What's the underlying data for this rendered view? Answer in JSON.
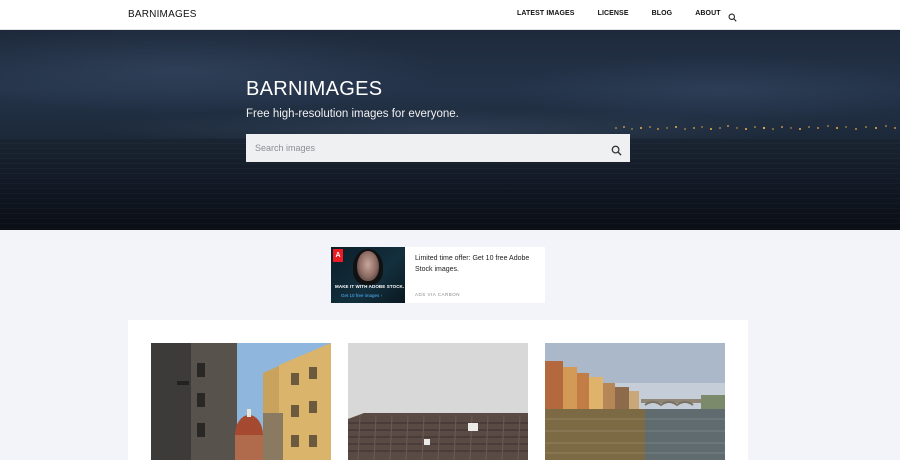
{
  "site": {
    "logo": "BARNIMAGES"
  },
  "nav": {
    "items": [
      {
        "label": "LATEST IMAGES"
      },
      {
        "label": "LICENSE"
      },
      {
        "label": "BLOG"
      },
      {
        "label": "ABOUT"
      }
    ],
    "search_icon": "search-icon"
  },
  "hero": {
    "title": "BARNIMAGES",
    "tagline": "Free high-resolution images for everyone.",
    "search_placeholder": "Search images",
    "search_icon": "search-icon"
  },
  "ad": {
    "caption": "MAKE IT WITH ADOBE STOCK.",
    "cta": "Get 10 free images ›",
    "logo": "Adobe",
    "text": "Limited time offer: Get 10 free Adobe Stock images.",
    "via": "ADS VIA CARBON"
  },
  "gallery": {
    "photos": [
      {
        "subject": "florence-street-duomo"
      },
      {
        "subject": "tiled-roof-overcast-sky"
      },
      {
        "subject": "arno-river-bridge"
      }
    ]
  },
  "colors": {
    "page_bg": "#f3f4f9",
    "nav_bg": "#ffffff",
    "hero_bg": "#1e2a3c",
    "search_bg": "#eef0f2",
    "adobe_red": "#ed1c24"
  }
}
